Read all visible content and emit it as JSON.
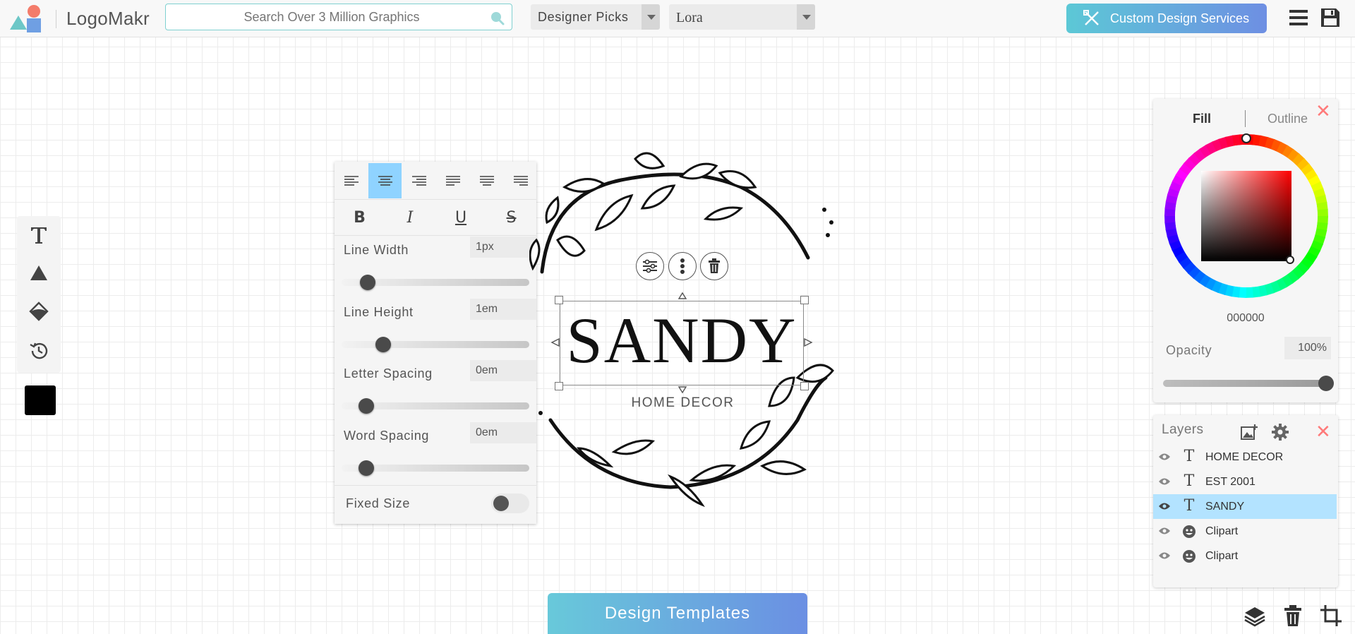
{
  "app": {
    "logo_text": "LogoMakr",
    "search_placeholder": "Search Over 3 Million Graphics",
    "designer_picks": "Designer Picks",
    "font_name": "Lora",
    "custom_design_label": "Custom Design Services"
  },
  "text_panel": {
    "line_width": {
      "label": "Line Width",
      "value": "1px",
      "slider": 0.14
    },
    "line_height": {
      "label": "Line Height",
      "value": "1em",
      "slider": 0.22
    },
    "letter_spacing": {
      "label": "Letter Spacing",
      "value": "0em",
      "slider": 0.13
    },
    "word_spacing": {
      "label": "Word Spacing",
      "value": "0em",
      "slider": 0.13
    },
    "fixed_size": {
      "label": "Fixed Size",
      "on": false
    },
    "bold": "B",
    "italic": "I",
    "underline": "U",
    "strike": "S",
    "active_alignment": "align-center"
  },
  "canvas": {
    "main_text": "SANDY",
    "sub_text": "HOME DECOR"
  },
  "color_panel": {
    "tab_fill": "Fill",
    "tab_outline": "Outline",
    "hex": "000000",
    "opacity_label": "Opacity",
    "opacity_value": "100%",
    "close": "✕"
  },
  "layers": {
    "title": "Layers",
    "close": "✕",
    "items": [
      {
        "type": "text",
        "name": "HOME DECOR",
        "selected": false
      },
      {
        "type": "text",
        "name": "EST 2001",
        "selected": false
      },
      {
        "type": "text",
        "name": "SANDY",
        "selected": true
      },
      {
        "type": "clipart",
        "name": "Clipart",
        "selected": false
      },
      {
        "type": "clipart",
        "name": "Clipart",
        "selected": false
      }
    ]
  },
  "bottom": {
    "templates_label": "Design Templates"
  },
  "colors": {
    "accent_selected": "#8fd3ff",
    "layer_selected": "#b3e3ff",
    "close_red": "#ff7a7a",
    "button_gradient_start": "#5cc8d6",
    "button_gradient_end": "#6e8fe3"
  },
  "icons": [
    "search-icon",
    "menu-icon",
    "save-icon",
    "text-tool-icon",
    "shape-tool-icon",
    "fill-tool-icon",
    "history-icon",
    "settings-icon",
    "more-icon",
    "trash-icon",
    "eye-icon",
    "add-image-icon",
    "gear-icon",
    "layers-icon",
    "crop-icon"
  ]
}
